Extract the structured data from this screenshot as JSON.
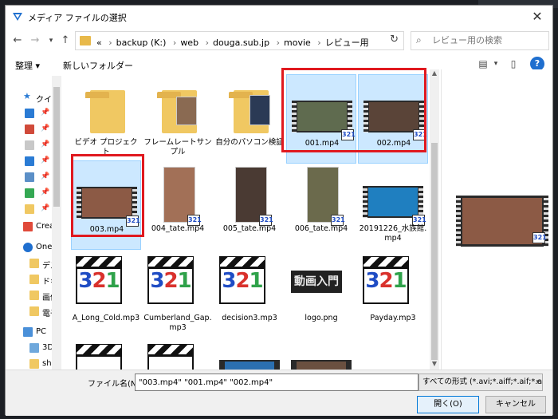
{
  "dialog": {
    "title": "メディア ファイルの選択",
    "close_symbol": "✕"
  },
  "address": {
    "prefix": "«",
    "crumbs": [
      "backup (K:)",
      "web",
      "douga.sub.jp",
      "movie",
      "レビュー用"
    ],
    "search_placeholder": "レビュー用の検索"
  },
  "toolbar": {
    "organize": "整理 ▾",
    "new_folder": "新しいフォルダー",
    "help_symbol": "?"
  },
  "nav_pane": {
    "items": [
      "クイ",
      "",
      "",
      "",
      "",
      "",
      "",
      "Crea",
      "One",
      "デス",
      "ドキ",
      "画像",
      "電子",
      "PC",
      "3D",
      "sha"
    ]
  },
  "files": [
    {
      "name": "ビデオ プロジェクト",
      "kind": "folder",
      "selected": false
    },
    {
      "name": "フレームレートサンプル",
      "kind": "folder",
      "selected": false
    },
    {
      "name": "自分のパソコン検証",
      "kind": "folder",
      "selected": false
    },
    {
      "name": "001.mp4",
      "kind": "video",
      "selected": true
    },
    {
      "name": "002.mp4",
      "kind": "video",
      "selected": true
    },
    {
      "name": "003.mp4",
      "kind": "video",
      "selected": true
    },
    {
      "name": "004_tate.mp4",
      "kind": "video",
      "selected": false
    },
    {
      "name": "005_tate.mp4",
      "kind": "video",
      "selected": false
    },
    {
      "name": "006_tate.mp4",
      "kind": "video",
      "selected": false
    },
    {
      "name": "20191226_水族館.mp4",
      "kind": "video",
      "selected": false
    },
    {
      "name": "A_Long_Cold.mp3",
      "kind": "audio",
      "selected": false
    },
    {
      "name": "Cumberland_Gap.mp3",
      "kind": "audio",
      "selected": false
    },
    {
      "name": "decision3.mp3",
      "kind": "audio",
      "selected": false
    },
    {
      "name": "logo.png",
      "kind": "image",
      "selected": false
    },
    {
      "name": "Payday.mp3",
      "kind": "audio",
      "selected": false
    }
  ],
  "badge_text": "321",
  "clap_digits": [
    "3",
    "2",
    "1"
  ],
  "logo_text": "動画入門",
  "bottom": {
    "filename_label": "ファイル名(N):",
    "filename_value": "\"003.mp4\" \"001.mp4\" \"002.mp4\"",
    "filter_value": "すべての形式 (*.avi;*.aiff;*.aif;*.ai",
    "open_label": "開く(O)",
    "cancel_label": "キャンセル"
  },
  "colors": {
    "highlight_red": "#e0191f",
    "selection_blue": "#cce8ff",
    "folder_yellow": "#f0c862"
  }
}
